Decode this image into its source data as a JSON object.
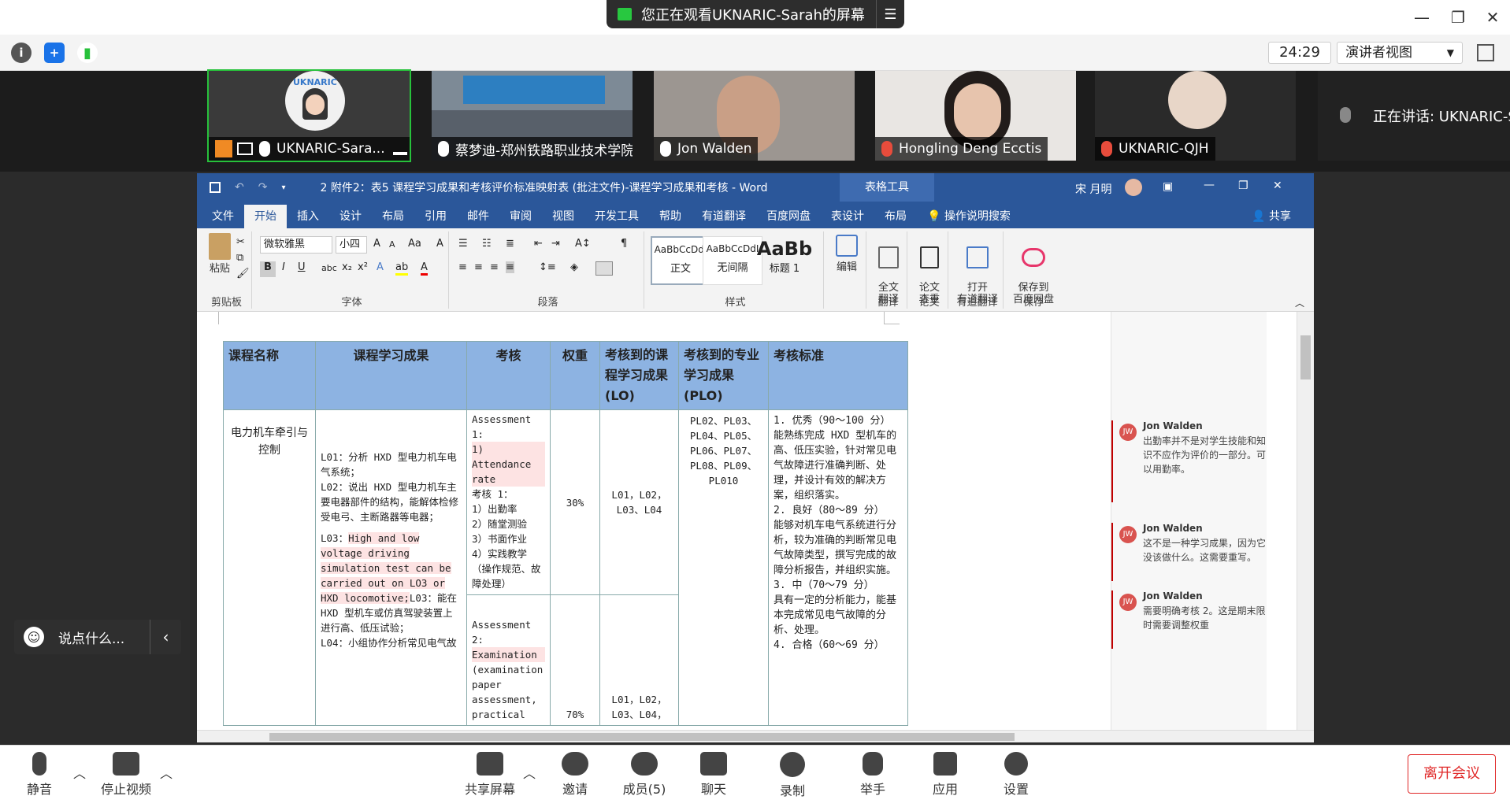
{
  "zoom": {
    "share_banner": "您正在观看UKNARIC-Sarah的屏幕",
    "timer": "24:29",
    "view_button": "演讲者视图",
    "participants": [
      {
        "name": "UKNARIC-Sara..."
      },
      {
        "name": "蔡梦迪-郑州铁路职业技术学院"
      },
      {
        "name": "Jon Walden"
      },
      {
        "name": "Hongling Deng Ecctis"
      },
      {
        "name": "UKNARIC-QJH"
      }
    ],
    "speaking": "正在讲话: UKNARIC-S",
    "logo_text": "UKNARIC",
    "chat_placeholder": "说点什么...",
    "toolbar": {
      "mute": "静音",
      "stop_video": "停止视频",
      "share": "共享屏幕",
      "invite": "邀请",
      "participants": "成员(5)",
      "chat": "聊天",
      "record": "录制",
      "raise_hand": "举手",
      "apps": "应用",
      "settings": "设置",
      "leave": "离开会议"
    },
    "colors": {
      "active_speaker": "#27c13b",
      "leave": "#e02828"
    }
  },
  "word": {
    "title": "2 附件2：表5 课程学习成果和考核评价标准映射表 (批注文件)-课程学习成果和考核  -  Word",
    "table_tools": "表格工具",
    "user": "宋 月明",
    "tabs": [
      "文件",
      "开始",
      "插入",
      "设计",
      "布局",
      "引用",
      "邮件",
      "审阅",
      "视图",
      "开发工具",
      "帮助",
      "有道翻译",
      "百度网盘",
      "表设计",
      "布局"
    ],
    "tell_me": "操作说明搜索",
    "share": "共享",
    "ribbon": {
      "paste": "粘贴",
      "clipboard": "剪贴板",
      "font_name": "微软雅黑",
      "font_size": "小四",
      "font": "字体",
      "paragraph": "段落",
      "styles": [
        {
          "preview": "AaBbCcDdI",
          "name": "正文"
        },
        {
          "preview": "AaBbCcDdI",
          "name": "无间隔"
        },
        {
          "preview": "AaBb",
          "name": "标题 1"
        }
      ],
      "styles_label": "样式",
      "edit": "编辑",
      "full_translate": "全文\n翻译",
      "translate": "翻译",
      "paper_check": "论文\n查重",
      "paper": "论文",
      "open_youdao": "打开\n有道翻译",
      "youdao": "有道翻译",
      "save_baidu": "保存到\n百度网盘",
      "save": "保存"
    },
    "table": {
      "headers": [
        "课程名称",
        "课程学习成果",
        "考核",
        "权重",
        "考核到的课程学习成果(LO)",
        "考核到的专业学习成果(PLO)",
        "考核标准"
      ],
      "course_name": "电力机车牵引与控制",
      "outcomes_1": "L01：分析 HXD 型电力机车电气系统；",
      "outcomes_2": "L02：说出 HXD 型电力机车主要电器部件的结构，能解体检修受电弓、主断路器等电器；",
      "outcomes_3_prefix": "L03：",
      "outcomes_3_en": "High and low voltage driving simulation test can be carried out on LO3 or HXD locomotive;",
      "outcomes_3_cn": "L03：能在 HXD 型机车或仿真驾驶装置上进行高、低压试验；",
      "outcomes_4": "L04：小组协作分析常见电气故",
      "assess1_title": "Assessment 1:",
      "assess1_en": "1) Attendance rate",
      "assess1_cn_title": "考核 1：",
      "assess1_items": [
        "1）出勤率",
        "2）随堂测验",
        "3）书面作业",
        "4）实践教学（操作规范、故障处理）"
      ],
      "assess2_title": "Assessment 2:",
      "assess2_en": "Examination",
      "assess2_desc": "(examination paper assessment, practical",
      "weight1": "30%",
      "weight2": "70%",
      "lo1": "L01，L02，L03、L04",
      "lo2": "L01，L02，L03、L04，",
      "plo": "PL02、PL03、PL04、PL05、PL06、PL07、PL08、PL09、PL010",
      "criteria": [
        "1. 优秀（90～100 分）",
        "能熟练完成 HXD 型机车的高、低压实验，针对常见电气故障进行准确判断、处理，并设计有效的解决方案，组织落实。",
        "2. 良好（80～89 分）",
        "能够对机车电气系统进行分析，较为准确的判断常见电气故障类型，撰写完成的故障分析报告，并组织实施。",
        "3. 中（70～79 分）",
        "具有一定的分析能力，能基本完成常见电气故障的分析、处理。",
        "4. 合格（60～69 分）"
      ]
    },
    "comments": [
      {
        "initials": "JW",
        "author": "Jon Walden",
        "text": "出勤率并不是对学生技能和知识不应作为评价的一部分。可以用勤率。"
      },
      {
        "initials": "JW",
        "author": "Jon Walden",
        "text": "这不是一种学习成果，因为它没该做什么。这需要重写。"
      },
      {
        "initials": "JW",
        "author": "Jon Walden",
        "text": "需要明确考核 2。这是期末限时需要调整权重"
      }
    ],
    "colors": {
      "title_bar": "#2b579a",
      "table_header": "#8db3e2",
      "comment_bar": "#c00000"
    }
  }
}
